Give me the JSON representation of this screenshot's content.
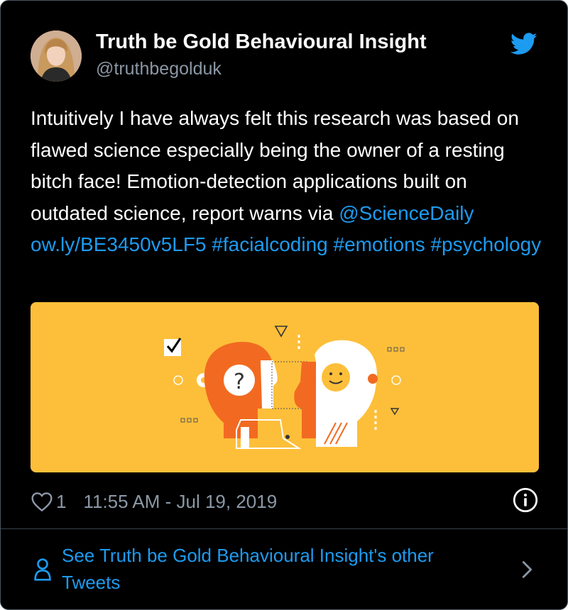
{
  "author": {
    "name": "Truth be Gold Behavioural Insight",
    "handle": "@truthbegolduk"
  },
  "tweet": {
    "text_before": "Intuitively I have always felt this research was based on flawed science especially being the owner of a resting bitch face! Emotion-detection applications built on outdated science, report warns via ",
    "mention": "@ScienceDaily",
    "link": "ow.ly/BE3450v5LF5",
    "hashtags": [
      "#facialcoding",
      "#emotions",
      "#psychology"
    ]
  },
  "meta": {
    "like_count": "1",
    "timestamp": "11:55 AM - Jul 19, 2019"
  },
  "footer": {
    "more_tweets_label": "See Truth be Gold Behavioural Insight's other Tweets"
  },
  "icons": {
    "brand": "twitter-bird-icon",
    "like": "heart-icon",
    "info": "info-icon",
    "person": "person-icon",
    "chevron": "chevron-right-icon"
  },
  "colors": {
    "background": "#000000",
    "link": "#1d9bf0",
    "secondary_text": "#8b98a5",
    "media_background": "#fdbf3a",
    "illustration_orange": "#f26a21"
  }
}
